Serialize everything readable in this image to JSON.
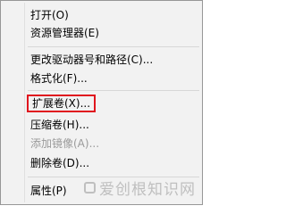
{
  "menu": {
    "items": [
      {
        "label": "打开(O)"
      },
      {
        "label": "资源管理器(E)"
      },
      {
        "label": "更改驱动器号和路径(C)..."
      },
      {
        "label": "格式化(F)..."
      },
      {
        "label": "扩展卷(X)..."
      },
      {
        "label": "压缩卷(H)..."
      },
      {
        "label": "添加镜像(A)..."
      },
      {
        "label": "删除卷(D)..."
      },
      {
        "label": "属性(P)"
      }
    ],
    "highlight_color": "#e0161e",
    "disabled_color": "#9a9a9a"
  },
  "watermark": {
    "text": "爱创根知识网"
  }
}
